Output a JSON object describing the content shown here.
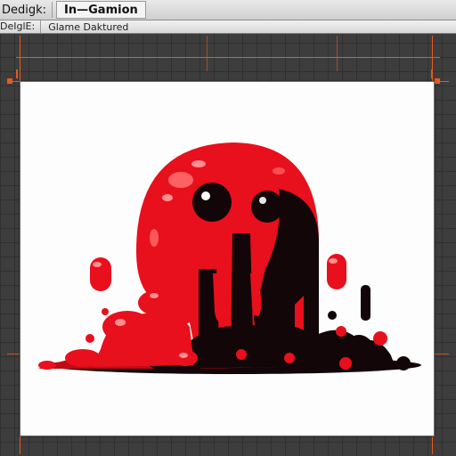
{
  "window": {
    "tab_editor": "Dedigk:",
    "tab_game": "In—Gamion"
  },
  "status": {
    "mode": "DeIglE:",
    "text": "Glame Daktured"
  },
  "sprite": {
    "subject": "red-slime-blob-sprite"
  },
  "colors": {
    "guide": "#e85a1a",
    "slime_red": "#e8101c",
    "slime_dark": "#120608",
    "highlight": "#ff6b6b",
    "canvas_bg": "#fdfdfd"
  }
}
